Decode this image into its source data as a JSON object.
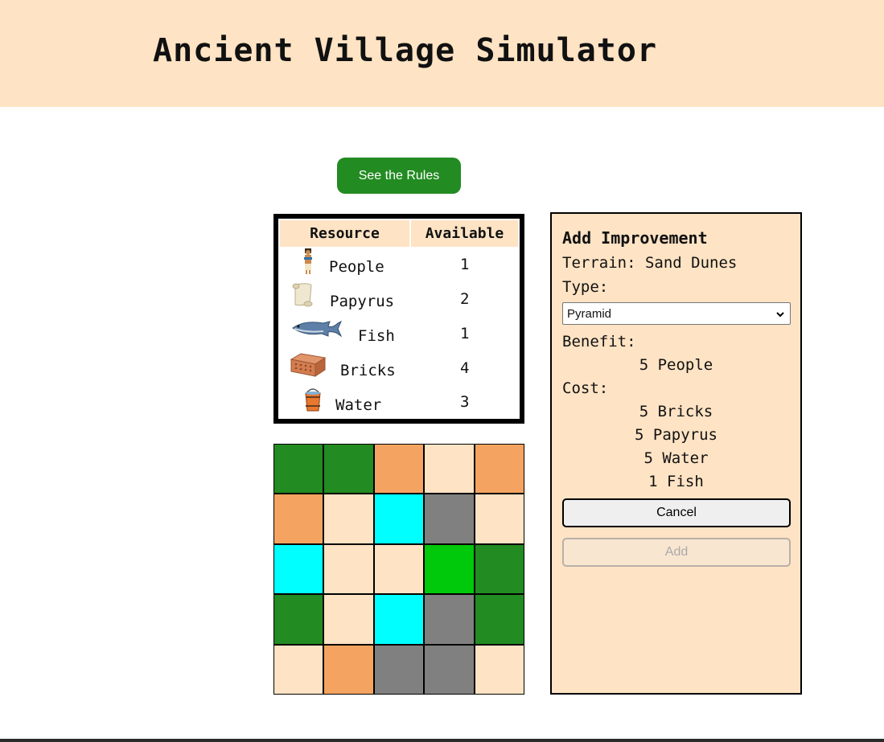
{
  "header": {
    "title": "Ancient Village Simulator"
  },
  "rules_button": {
    "label": "See the Rules"
  },
  "resources": {
    "headers": [
      "Resource",
      "Available"
    ],
    "rows": [
      {
        "name": "People",
        "value": "1",
        "icon": "person-icon"
      },
      {
        "name": "Papyrus",
        "value": "2",
        "icon": "scroll-icon"
      },
      {
        "name": "Fish",
        "value": "1",
        "icon": "fish-icon"
      },
      {
        "name": "Bricks",
        "value": "4",
        "icon": "brick-icon"
      },
      {
        "name": "Water",
        "value": "3",
        "icon": "bucket-icon"
      }
    ]
  },
  "map": {
    "colors": {
      "forest": "#228b22",
      "desert": "#f4a460",
      "sand_dunes": "#fee3c4",
      "water": "#00ffff",
      "mountain": "#808080",
      "grassland": "#00c80a"
    },
    "cells": [
      [
        "forest",
        "forest",
        "desert",
        "sand_dunes",
        "desert"
      ],
      [
        "desert",
        "sand_dunes",
        "water",
        "mountain",
        "sand_dunes"
      ],
      [
        "water",
        "sand_dunes",
        "sand_dunes",
        "grassland",
        "forest"
      ],
      [
        "forest",
        "sand_dunes",
        "water",
        "mountain",
        "forest"
      ],
      [
        "sand_dunes",
        "desert",
        "mountain",
        "mountain",
        "sand_dunes"
      ]
    ]
  },
  "improvement": {
    "title": "Add Improvement",
    "terrain": "Terrain: Sand Dunes",
    "type_label": "Type:",
    "type_value": "Pyramid",
    "benefit_label": "Benefit:",
    "benefits": [
      "5 People"
    ],
    "cost_label": "Cost:",
    "costs": [
      "5 Bricks",
      "5 Papyrus",
      "5 Water",
      "1 Fish"
    ],
    "cancel_label": "Cancel",
    "add_label": "Add"
  }
}
